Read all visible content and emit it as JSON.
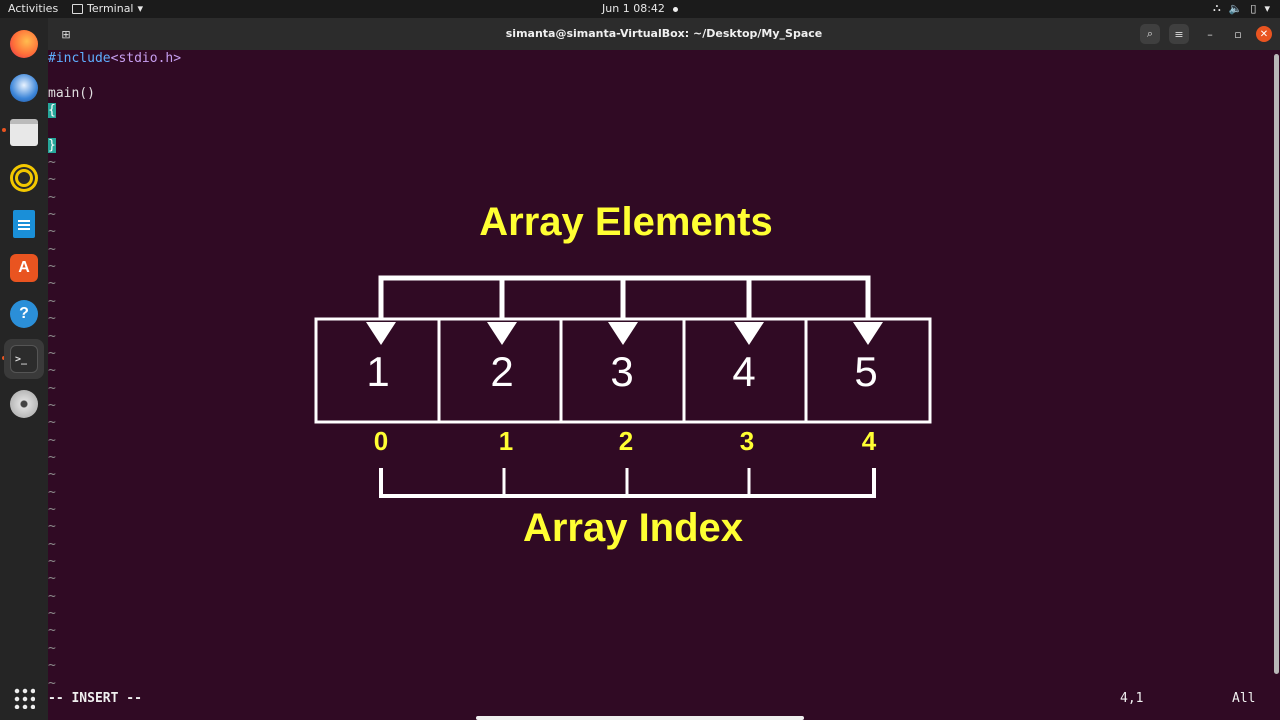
{
  "topbar": {
    "activities": "Activities",
    "app_name": "Terminal",
    "clock": "Jun 1  08:42"
  },
  "window": {
    "title": "simanta@simanta-VirtualBox: ~/Desktop/My_Space"
  },
  "dock": {
    "items": [
      "firefox-icon",
      "thunderbird-icon",
      "files-icon",
      "rhythmbox-icon",
      "writer-icon",
      "software-icon",
      "help-icon",
      "terminal-icon",
      "dvd-icon",
      "apps-grid-icon"
    ]
  },
  "editor": {
    "include_kw": "#include",
    "include_hdr": "<stdio.h>",
    "main_line": "main()",
    "open_brace": "{",
    "close_brace": "}",
    "tilde": "~"
  },
  "statusline": {
    "mode": "-- INSERT --",
    "position": "4,1",
    "scroll": "All"
  },
  "diagram": {
    "title_top": "Array Elements",
    "title_bottom": "Array Index",
    "elements": [
      "1",
      "2",
      "3",
      "4",
      "5"
    ],
    "indices": [
      "0",
      "1",
      "2",
      "3",
      "4"
    ],
    "accent_color": "#ffff33"
  }
}
